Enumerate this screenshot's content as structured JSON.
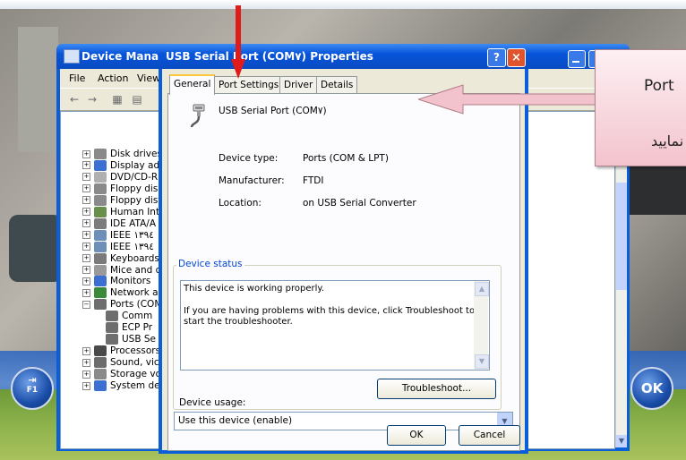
{
  "device_manager": {
    "title": "Device Manager",
    "menu": [
      "File",
      "Action",
      "View"
    ],
    "tree": [
      {
        "label": "Disk drives",
        "expander": "+"
      },
      {
        "label": "Display ad",
        "expander": "+"
      },
      {
        "label": "DVD/CD-R",
        "expander": "+"
      },
      {
        "label": "Floppy dis",
        "expander": "+"
      },
      {
        "label": "Floppy dist",
        "expander": "+"
      },
      {
        "label": "Human Int",
        "expander": "+"
      },
      {
        "label": "IDE ATA/A",
        "expander": "+"
      },
      {
        "label": "IEEE ١٣٩٤",
        "expander": "+"
      },
      {
        "label": "IEEE ١٣٩٤",
        "expander": "+"
      },
      {
        "label": "Keyboards",
        "expander": "+"
      },
      {
        "label": "Mice and c",
        "expander": "+"
      },
      {
        "label": "Monitors",
        "expander": "+"
      },
      {
        "label": "Network a",
        "expander": "+"
      },
      {
        "label": "Ports (COM",
        "expander": "−"
      },
      {
        "label": "Comm",
        "expander": ""
      },
      {
        "label": "ECP Pr",
        "expander": ""
      },
      {
        "label": "USB Se",
        "expander": ""
      },
      {
        "label": "Processors",
        "expander": "+"
      },
      {
        "label": "Sound, vic",
        "expander": "+"
      },
      {
        "label": "Storage vo",
        "expander": "+"
      },
      {
        "label": "System de",
        "expander": "+"
      }
    ]
  },
  "dialog": {
    "title": "USB Serial Port (COM٧) Properties",
    "help_button": "?",
    "close_button": "×",
    "tabs": [
      "General",
      "Port Settings",
      "Driver",
      "Details"
    ],
    "active_tab": "General",
    "device_name": "USB Serial Port (COM٧)",
    "properties": {
      "device_type_label": "Device type:",
      "device_type_value": "Ports (COM & LPT)",
      "manufacturer_label": "Manufacturer:",
      "manufacturer_value": "FTDI",
      "location_label": "Location:",
      "location_value": "on USB Serial Converter"
    },
    "status_group_title": "Device status",
    "status_lines": [
      "This device is working properly.",
      "",
      "If you are having problems with this device, click Troubleshoot to",
      "start the troubleshooter."
    ],
    "troubleshoot_button": "Troubleshoot...",
    "usage_label": "Device usage:",
    "usage_value": "Use this device (enable)",
    "ok_button": "OK",
    "cancel_button": "Cancel"
  },
  "overlay": {
    "callout_line1": "Port",
    "callout_line2": "نمایید"
  },
  "keys": {
    "f1_label": "F1",
    "ok_label": "OK"
  },
  "colors": {
    "xp_title_blue": "#0a5ed8",
    "dialog_face": "#ece9d8",
    "annotation_red": "#e11a1a",
    "callout_pink": "#f3c3cd",
    "group_title_blue": "#0046d5"
  }
}
